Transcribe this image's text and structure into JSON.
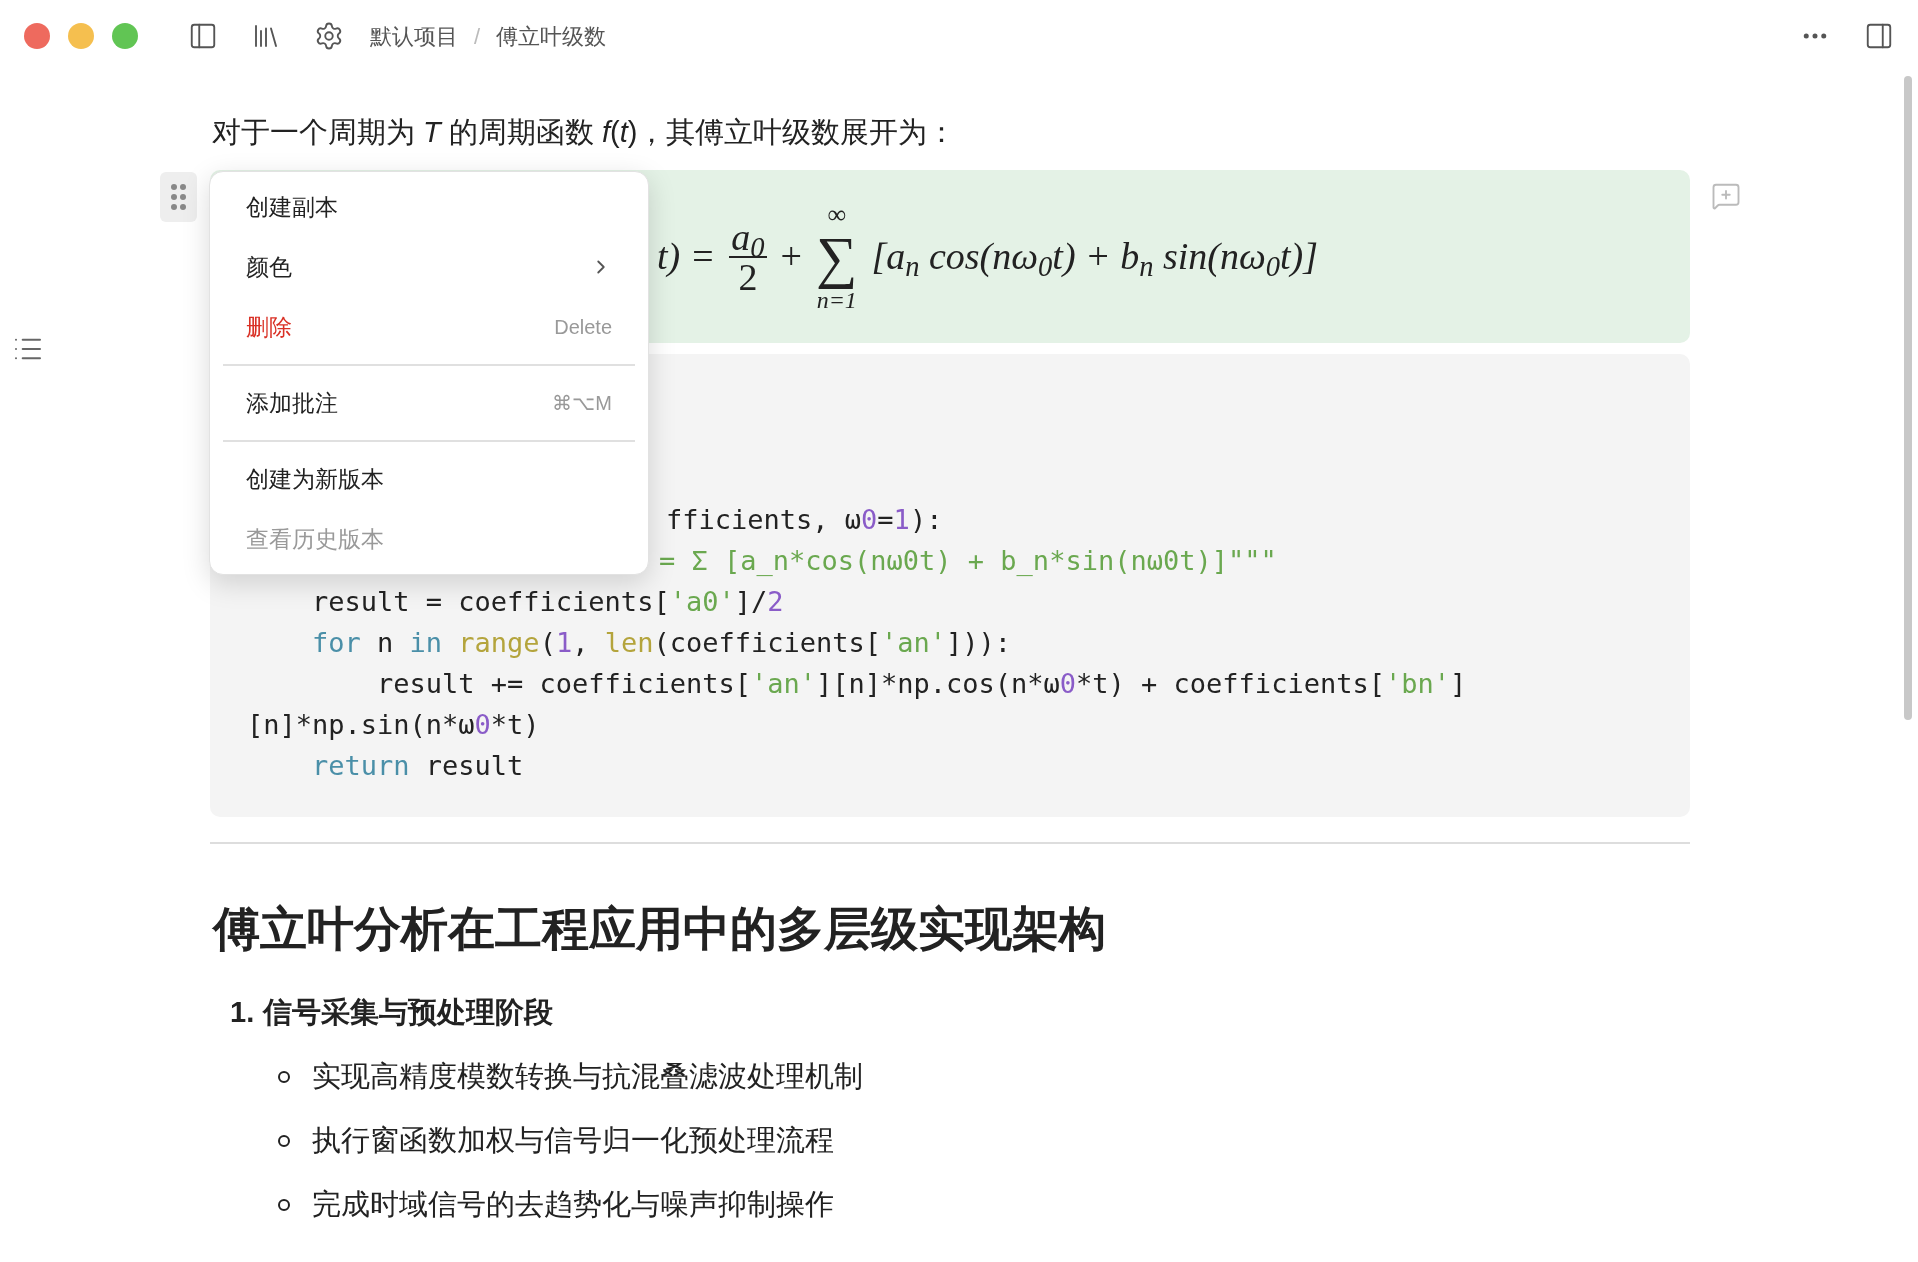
{
  "breadcrumb": [
    "默认项目",
    "傅立叶级数"
  ],
  "breadcrumb_separator": "/",
  "intro": "对于一个周期为 *T* 的周期函数 *f*(*t*)，其傅立叶级数展开为：",
  "formula": {
    "lhs_tail": "t) =",
    "numerator": "a$_{0}$",
    "denominator": "2",
    "plus": "+",
    "sum": "∑",
    "upper": "∞",
    "lower": "n=1",
    "body": "[a$_{n}$ cos(nω$_{0}$t) + b$_{n}$ sin(nω$_{0}$t)]"
  },
  "code": {
    "lines": [
      {
        "kind": "tail_a",
        "tokens": [
          {
            "text": "fficients, ω",
            "kind": "plain"
          },
          {
            "text": "0",
            "kind": "number"
          },
          {
            "text": "=",
            "kind": "plain"
          },
          {
            "text": "1",
            "kind": "number"
          },
          {
            "text": "):",
            "kind": "plain"
          }
        ]
      },
      {
        "kind": "tail_b",
        "tokens": [
          {
            "text": "= Σ [a_n*cos(nω0t) + b_n*sin(nω0t)]\"\"\"",
            "kind": "string"
          }
        ]
      },
      {
        "kind": "full",
        "tokens": [
          {
            "text": "    result = coefficients[",
            "kind": "plain"
          },
          {
            "text": "'a0'",
            "kind": "string"
          },
          {
            "text": "]/",
            "kind": "plain"
          },
          {
            "text": "2",
            "kind": "number"
          }
        ]
      },
      {
        "kind": "full",
        "tokens": [
          {
            "text": "    for",
            "kind": "keyword"
          },
          {
            "text": " n ",
            "kind": "plain"
          },
          {
            "text": "in",
            "kind": "keyword"
          },
          {
            "text": " range",
            "kind": "builtin"
          },
          {
            "text": "(",
            "kind": "plain"
          },
          {
            "text": "1",
            "kind": "number"
          },
          {
            "text": ", ",
            "kind": "plain"
          },
          {
            "text": "len",
            "kind": "builtin"
          },
          {
            "text": "(coefficients[",
            "kind": "plain"
          },
          {
            "text": "'an'",
            "kind": "string"
          },
          {
            "text": "])):",
            "kind": "plain"
          }
        ]
      },
      {
        "kind": "full",
        "tokens": [
          {
            "text": "        result += coefficients[",
            "kind": "plain"
          },
          {
            "text": "'an'",
            "kind": "string"
          },
          {
            "text": "][n]*np.cos(n*ω",
            "kind": "plain"
          },
          {
            "text": "0",
            "kind": "number"
          },
          {
            "text": "*t) + coefficients[",
            "kind": "plain"
          },
          {
            "text": "'bn'",
            "kind": "string"
          },
          {
            "text": "]",
            "kind": "plain"
          }
        ]
      },
      {
        "kind": "full",
        "tokens": [
          {
            "text": "[n]*np.sin(n*ω",
            "kind": "plain"
          },
          {
            "text": "0",
            "kind": "number"
          },
          {
            "text": "*t)",
            "kind": "plain"
          }
        ]
      },
      {
        "kind": "full",
        "tokens": [
          {
            "text": "    return",
            "kind": "keyword"
          },
          {
            "text": " result",
            "kind": "plain"
          }
        ]
      }
    ]
  },
  "heading": "傅立叶分析在工程应用中的多层级实现架构",
  "list": [
    {
      "number": "1.",
      "title": "信号采集与预处理阶段",
      "children": [
        "实现高精度模数转换与抗混叠滤波处理机制",
        "执行窗函数加权与信号归一化预处理流程",
        "完成时域信号的去趋势化与噪声抑制操作"
      ]
    }
  ],
  "context_menu": {
    "groups": [
      [
        {
          "label": "创建副本",
          "kind": "normal",
          "disabled": false
        },
        {
          "label": "颜色",
          "kind": "submenu",
          "disabled": false
        },
        {
          "label": "删除",
          "kind": "danger",
          "shortcut": "Delete",
          "disabled": false
        }
      ],
      [
        {
          "label": "添加批注",
          "kind": "normal",
          "shortcut": "⌘⌥M",
          "disabled": false
        }
      ],
      [
        {
          "label": "创建为新版本",
          "kind": "normal",
          "disabled": false
        },
        {
          "label": "查看历史版本",
          "kind": "normal",
          "disabled": true
        }
      ]
    ]
  }
}
